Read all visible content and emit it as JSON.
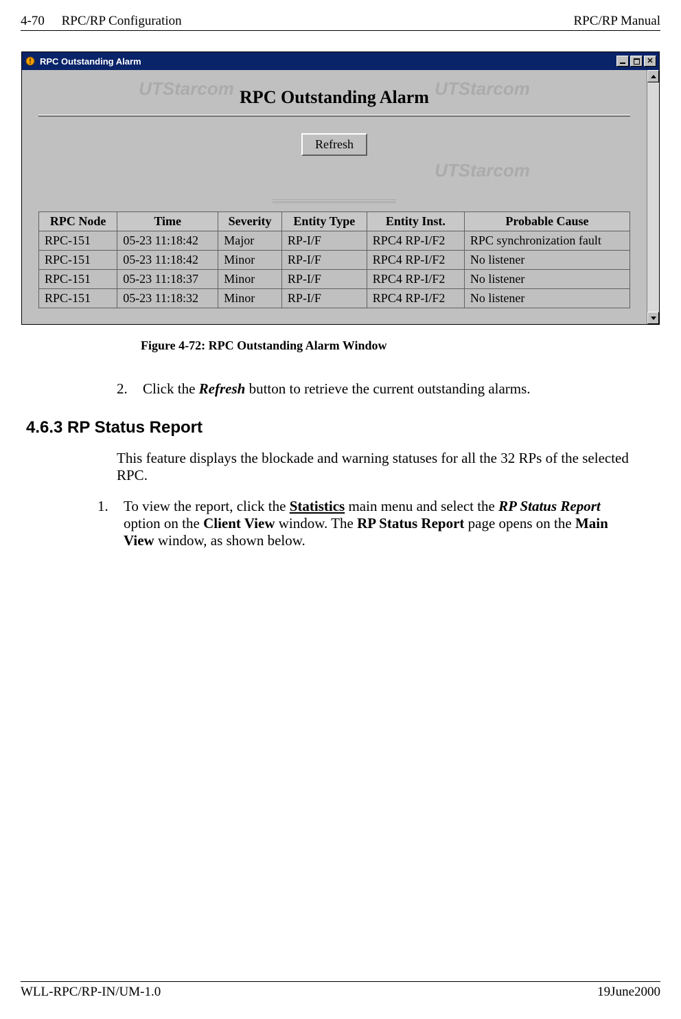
{
  "header": {
    "page_num": "4-70",
    "section": "RPC/RP Configuration",
    "manual": "RPC/RP Manual"
  },
  "window": {
    "title": "RPC Outstanding Alarm",
    "watermark": "UTStarcom",
    "page_heading": "RPC Outstanding Alarm",
    "refresh_label": "Refresh",
    "columns": {
      "node": "RPC Node",
      "time": "Time",
      "severity": "Severity",
      "entity_type": "Entity Type",
      "entity_inst": "Entity Inst.",
      "cause": "Probable Cause"
    },
    "rows": [
      {
        "node": "RPC-151",
        "time": "05-23 11:18:42",
        "severity": "Major",
        "entity_type": "RP-I/F",
        "entity_inst": "RPC4 RP-I/F2",
        "cause": "RPC synchronization fault"
      },
      {
        "node": "RPC-151",
        "time": "05-23 11:18:42",
        "severity": "Minor",
        "entity_type": "RP-I/F",
        "entity_inst": "RPC4 RP-I/F2",
        "cause": "No listener"
      },
      {
        "node": "RPC-151",
        "time": "05-23 11:18:37",
        "severity": "Minor",
        "entity_type": "RP-I/F",
        "entity_inst": "RPC4 RP-I/F2",
        "cause": "No listener"
      },
      {
        "node": "RPC-151",
        "time": "05-23 11:18:32",
        "severity": "Minor",
        "entity_type": "RP-I/F",
        "entity_inst": "RPC4 RP-I/F2",
        "cause": "No listener"
      }
    ]
  },
  "figure_caption": "Figure 4-72: RPC Outstanding Alarm Window",
  "step2": {
    "num": "2.",
    "pre": "Click the ",
    "bold": "Refresh",
    "post": " button to retrieve the current outstanding alarms."
  },
  "section_heading": "4.6.3  RP Status Report",
  "intro_para": "This feature displays the blockade and warning statuses for all the 32 RPs of the selected RPC.",
  "step1": {
    "num": "1.",
    "t1": "To view the report, click the ",
    "u1": "Statistics",
    "t2": " main menu and select the ",
    "bi1": "RP Status Report",
    "t3": " option on the ",
    "b1": "Client View",
    "t4": " window.  The ",
    "b2": "RP Status Report",
    "t5": " page opens on the ",
    "b3": "Main View",
    "t6": " window, as shown below."
  },
  "footer": {
    "left": "WLL-RPC/RP-IN/UM-1.0",
    "right": "19June2000"
  }
}
